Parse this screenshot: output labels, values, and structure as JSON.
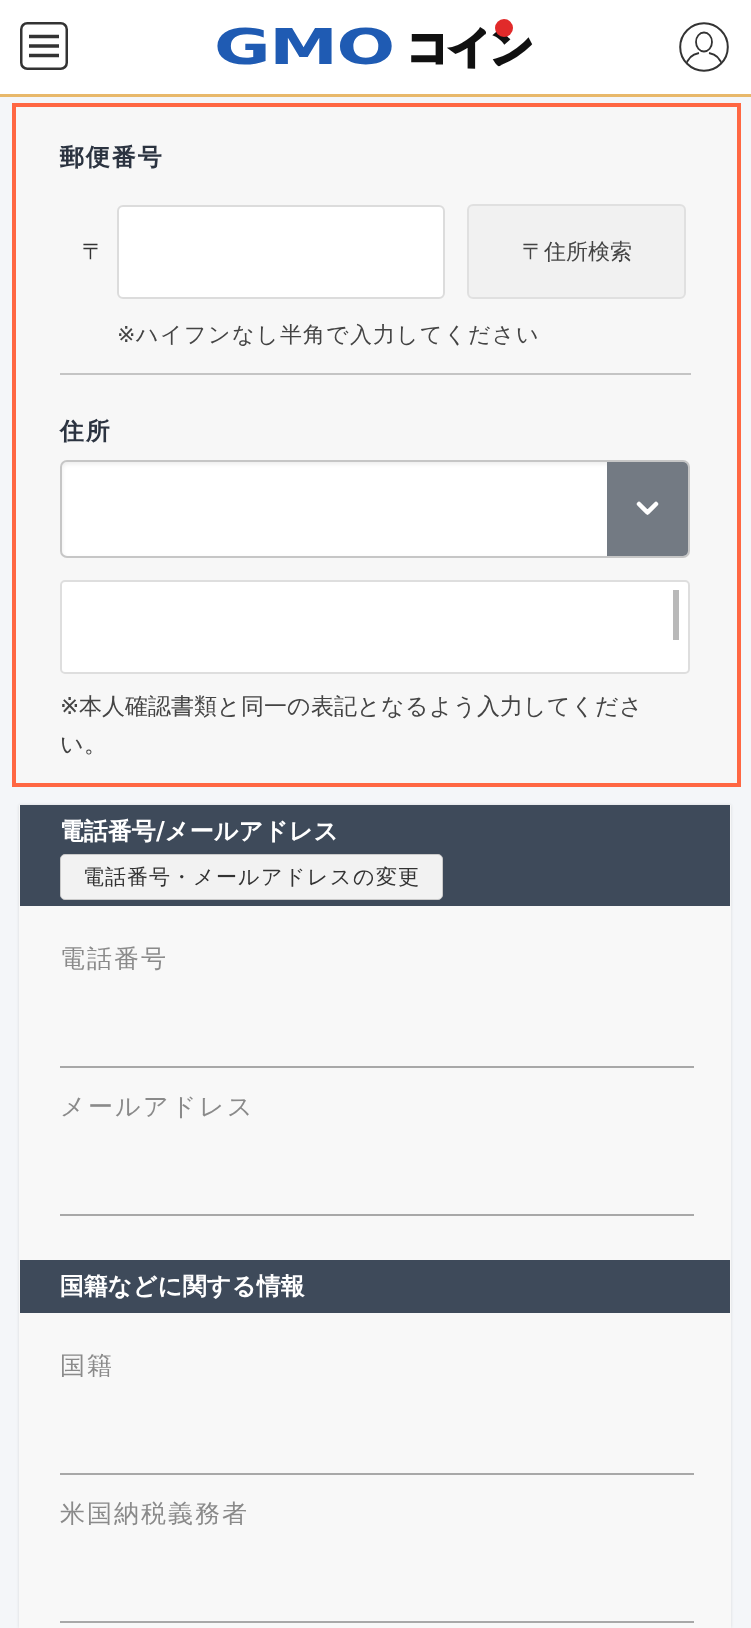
{
  "header": {
    "logo": {
      "brand": "GMO",
      "product": "コイン"
    }
  },
  "address_form": {
    "highlighted": true,
    "postal_code": {
      "label": "郵便番号",
      "prefix": "〒",
      "search_button": "〒住所検索",
      "hint": "※ハイフンなし半角で入力してください"
    },
    "address": {
      "label": "住所",
      "note": "※本人確認書類と同一の表記となるよう入力してください。"
    }
  },
  "sections": [
    {
      "title": "電話番号/メールアドレス",
      "button": "電話番号・メールアドレスの変更",
      "fields": [
        {
          "label": "電話番号"
        },
        {
          "label": "メールアドレス"
        }
      ]
    },
    {
      "title": "国籍などに関する情報",
      "fields": [
        {
          "label": "国籍"
        },
        {
          "label": "米国納税義務者"
        }
      ]
    }
  ]
}
